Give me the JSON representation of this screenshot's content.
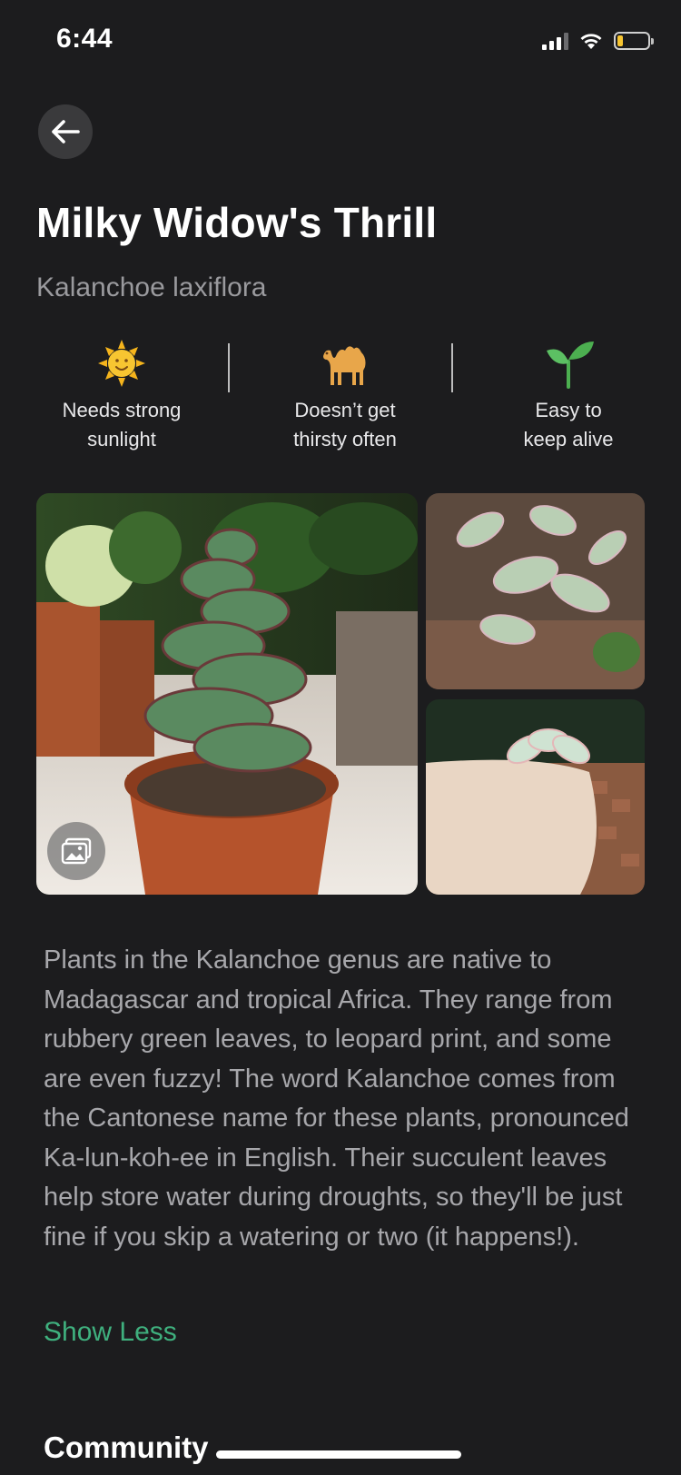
{
  "status_bar": {
    "time": "6:44",
    "icons": [
      "signal-icon",
      "wifi-icon",
      "battery-icon"
    ],
    "battery_level": 0.2,
    "battery_color": "#f7c531"
  },
  "header": {
    "back_icon": "arrow-left-icon"
  },
  "plant": {
    "common_name": "Milky Widow's Thrill",
    "scientific_name": "Kalanchoe laxiflora"
  },
  "traits": [
    {
      "icon": "sun-icon",
      "label": "Needs strong\nsunlight"
    },
    {
      "icon": "camel-icon",
      "label": "Doesn’t get\nthirsty often"
    },
    {
      "icon": "seedling-icon",
      "label": "Easy to\nkeep alive"
    }
  ],
  "gallery": {
    "icon": "gallery-icon"
  },
  "description": "Plants in the Kalanchoe genus are native to Madagascar and tropical Africa. They range from rubbery green leaves, to leopard print, and some are even fuzzy! The word Kalanchoe comes from the Cantonese name for these plants, pronounced Ka-lun-koh-ee in English. Their succulent leaves help store water during droughts, so they'll be just fine if you skip a watering or two (it happens!).",
  "show_less_label": "Show Less",
  "sections": {
    "community": "Community"
  },
  "colors": {
    "background": "#1c1c1e",
    "accent": "#3fb07e",
    "body_text": "#a7a7ab"
  }
}
